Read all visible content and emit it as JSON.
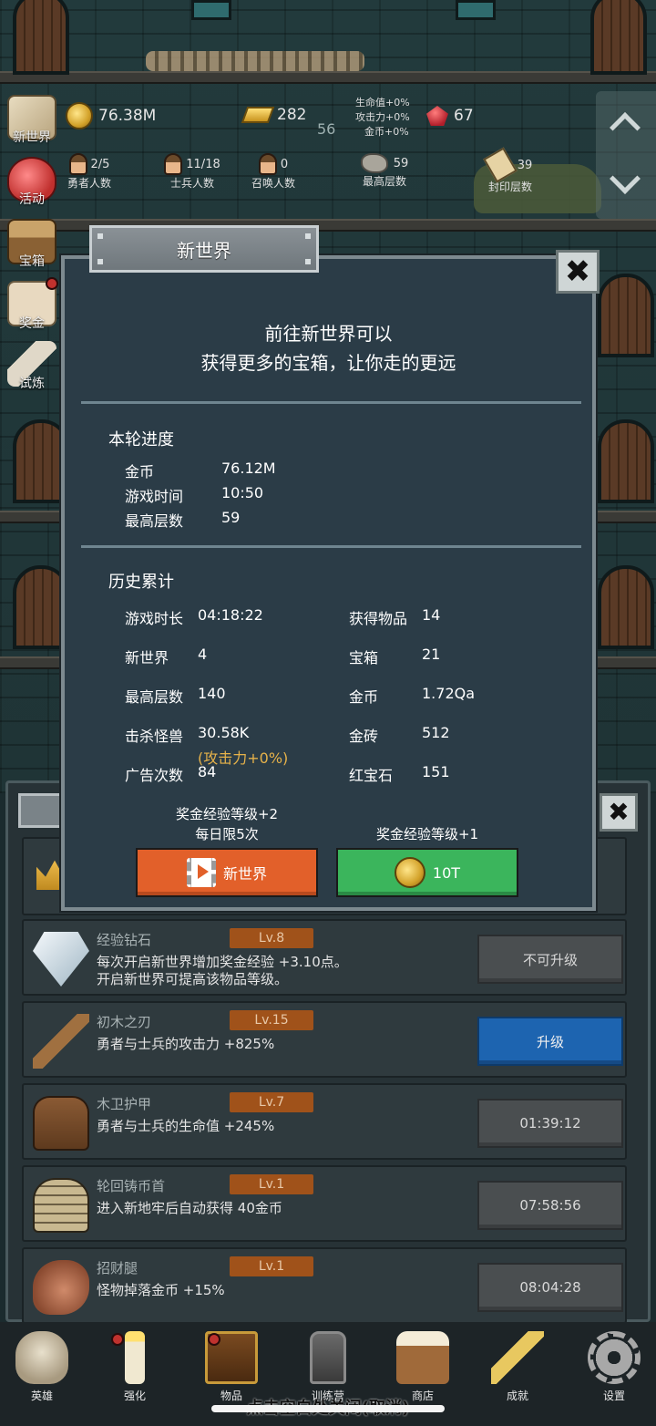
{
  "hud": {
    "gold": "76.38M",
    "gold_bars": "282",
    "center_num": "56",
    "bonus_lines": [
      "生命值+0%",
      "攻击力+0%",
      "金币+0%"
    ],
    "rubies": "67",
    "heroes": {
      "value": "2/5",
      "label": "勇者人数"
    },
    "soldiers": {
      "value": "11/18",
      "label": "士兵人数"
    },
    "summons": {
      "value": "0",
      "label": "召唤人数"
    },
    "max_floor": {
      "value": "59",
      "label": "最高层数"
    },
    "seal_floor": {
      "value": "39",
      "label": "封印层数"
    }
  },
  "side_menu": [
    {
      "label": "新世界",
      "icon": "map-icon"
    },
    {
      "label": "活动",
      "icon": "heart-icon"
    },
    {
      "label": "宝箱",
      "icon": "chest-icon"
    },
    {
      "label": "奖金",
      "icon": "envelope-icon"
    },
    {
      "label": "试炼",
      "icon": "feather-icon"
    }
  ],
  "modal": {
    "title": "新世界",
    "close_label": "✖",
    "intro_line1": "前往新世界可以",
    "intro_line2": "获得更多的宝箱，让你走的更远",
    "current_title": "本轮进度",
    "current": [
      {
        "k": "金币",
        "v": "76.12M"
      },
      {
        "k": "游戏时间",
        "v": "10:50"
      },
      {
        "k": "最高层数",
        "v": "59"
      }
    ],
    "history_title": "历史累计",
    "history_left": [
      {
        "k": "游戏时长",
        "v": "04:18:22"
      },
      {
        "k": "新世界",
        "v": "4"
      },
      {
        "k": "最高层数",
        "v": "140"
      },
      {
        "k": "击杀怪兽",
        "v": "30.58K"
      },
      {
        "k": "广告次数",
        "v": "84"
      }
    ],
    "atk_bonus": "(攻击力+0%)",
    "history_right": [
      {
        "k": "获得物品",
        "v": "14"
      },
      {
        "k": "宝箱",
        "v": "21"
      },
      {
        "k": "金币",
        "v": "1.72Qa"
      },
      {
        "k": "金砖",
        "v": "512"
      },
      {
        "k": "红宝石",
        "v": "151"
      }
    ],
    "left_caption_1": "奖金经验等级+2",
    "left_caption_2": "每日限5次",
    "right_caption": "奖金经验等级+1",
    "left_button": "新世界",
    "right_button": "10T"
  },
  "items": [
    {
      "name": "经验钻石",
      "lv": "Lv.8",
      "desc1": "每次开启新世界增加奖金经验 +3.10点。",
      "desc2": "开启新世界可提高该物品等级。",
      "button": "不可升级",
      "icon": "diamond-icon"
    },
    {
      "name": "初木之刃",
      "lv": "Lv.15",
      "desc1": "勇者与士兵的攻击力 +825%",
      "desc2": "",
      "button": "升级",
      "icon": "wooden-sword-icon"
    },
    {
      "name": "木卫护甲",
      "lv": "Lv.7",
      "desc1": "勇者与士兵的生命值 +245%",
      "desc2": "",
      "button": "01:39:12",
      "icon": "wooden-armor-icon"
    },
    {
      "name": "轮回铸币首",
      "lv": "Lv.1",
      "desc1": "进入新地牢后自动获得 40金币",
      "desc2": "",
      "button": "07:58:56",
      "icon": "knight-helmet-icon"
    },
    {
      "name": "招财腿",
      "lv": "Lv.1",
      "desc1": "怪物掉落金币 +15%",
      "desc2": "",
      "button": "08:04:28",
      "icon": "ham-leg-icon"
    }
  ],
  "nav": [
    {
      "label": "英雄",
      "icon": "skull-icon"
    },
    {
      "label": "强化",
      "icon": "candle-icon"
    },
    {
      "label": "物品",
      "icon": "book-icon"
    },
    {
      "label": "训练营",
      "icon": "lantern-icon"
    },
    {
      "label": "商店",
      "icon": "beer-mug-icon"
    },
    {
      "label": "成就",
      "icon": "key-icon"
    },
    {
      "label": "设置",
      "icon": "gear-icon"
    }
  ],
  "hint": "点击空白处关闭(取消)",
  "colors": {
    "modal_bg": "#2b3c47",
    "orange": "#e2602a",
    "green": "#3bb55c",
    "blue": "#1d64b0",
    "lv_badge": "#a0521a",
    "atk_bonus": "#e6b24a"
  }
}
